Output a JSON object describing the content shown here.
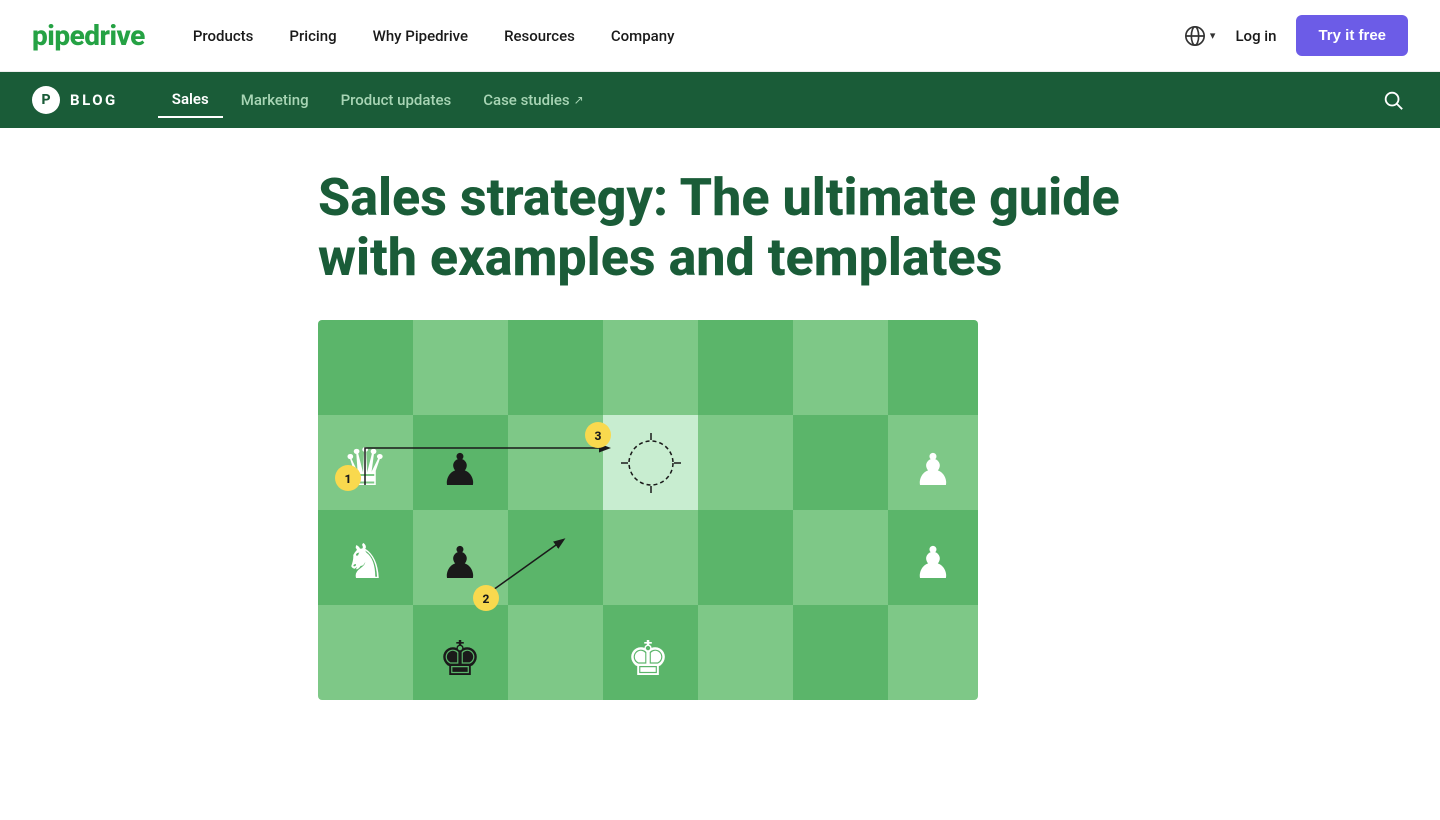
{
  "brand": {
    "name": "pipedrive",
    "logo_text": "pipedrive"
  },
  "top_nav": {
    "links": [
      {
        "label": "Products",
        "id": "products"
      },
      {
        "label": "Pricing",
        "id": "pricing"
      },
      {
        "label": "Why Pipedrive",
        "id": "why-pipedrive"
      },
      {
        "label": "Resources",
        "id": "resources"
      },
      {
        "label": "Company",
        "id": "company"
      }
    ],
    "login_label": "Log in",
    "try_free_label": "Try it free"
  },
  "blog_nav": {
    "logo_letter": "P",
    "blog_label": "BLOG",
    "links": [
      {
        "label": "Sales",
        "id": "sales",
        "active": true
      },
      {
        "label": "Marketing",
        "id": "marketing",
        "active": false
      },
      {
        "label": "Product updates",
        "id": "product-updates",
        "active": false
      },
      {
        "label": "Case studies",
        "id": "case-studies",
        "active": false,
        "external": true
      }
    ]
  },
  "article": {
    "title": "Sales strategy: The ultimate guide with examples and templates"
  },
  "chess": {
    "badge_1": "1",
    "badge_2": "2",
    "badge_3": "3"
  },
  "colors": {
    "dark_green": "#1a5c38",
    "mid_green": "#25a244",
    "purple": "#6c5ce7",
    "yellow": "#f9d94e"
  }
}
